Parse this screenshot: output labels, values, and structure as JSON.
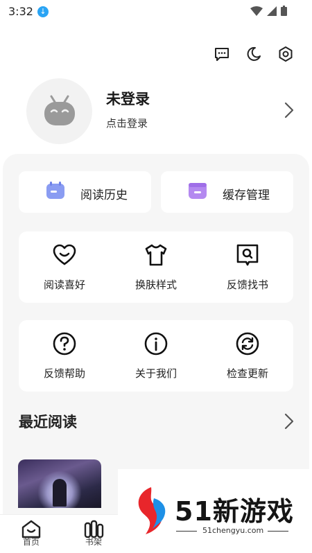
{
  "status_bar": {
    "time": "3:32"
  },
  "profile": {
    "name": "未登录",
    "subtitle": "点击登录"
  },
  "quick_actions": [
    {
      "label": "阅读历史",
      "icon": "calendar-icon",
      "color": "#8a9cf2"
    },
    {
      "label": "缓存管理",
      "icon": "cache-box-icon",
      "color": "#b489f0"
    }
  ],
  "grid_row1": [
    {
      "label": "阅读喜好",
      "icon": "heart-smile-icon"
    },
    {
      "label": "换肤样式",
      "icon": "tshirt-icon"
    },
    {
      "label": "反馈找书",
      "icon": "book-search-icon"
    }
  ],
  "grid_row2": [
    {
      "label": "反馈帮助",
      "icon": "question-icon"
    },
    {
      "label": "关于我们",
      "icon": "info-icon"
    },
    {
      "label": "检查更新",
      "icon": "refresh-icon"
    }
  ],
  "recent": {
    "title": "最近阅读"
  },
  "tabs": [
    {
      "label": "首页",
      "icon": "home-icon"
    },
    {
      "label": "书架",
      "icon": "bookshelf-icon"
    }
  ],
  "watermark": {
    "name": "51新游戏",
    "url": "51chengyu.com"
  },
  "colors": {
    "panel_bg": "#f6f6f6",
    "accent_blue": "#2aa4f4"
  }
}
